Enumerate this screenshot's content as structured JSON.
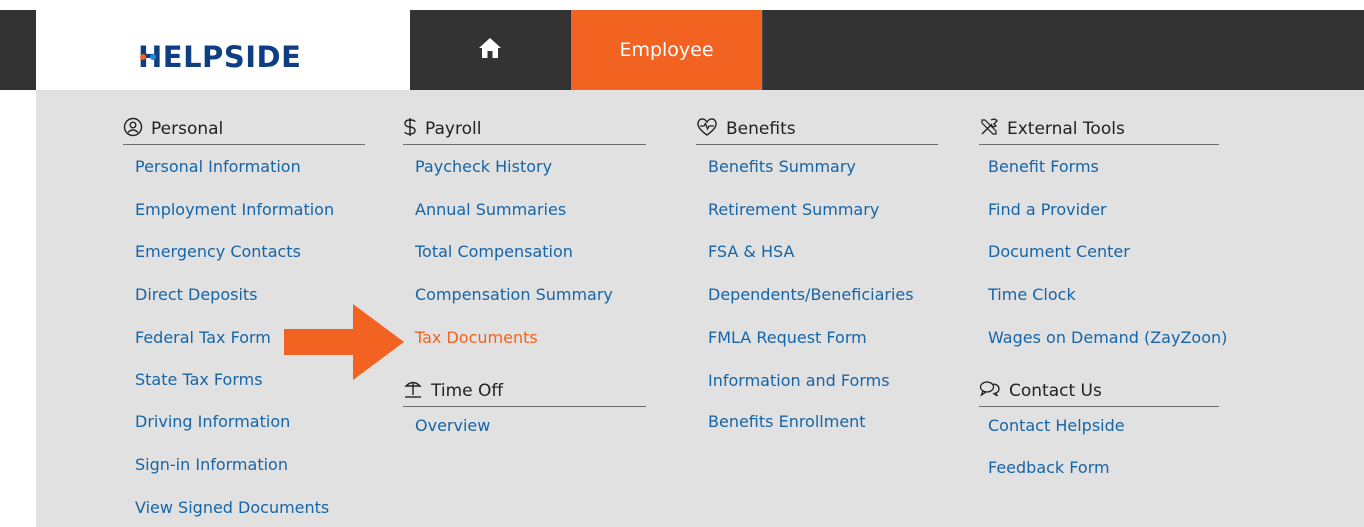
{
  "top_fragment": "(",
  "brand": {
    "name": "HELPSIDE",
    "dot_colors": [
      "#f26322",
      "#1e88e5"
    ],
    "color": "#0f3f82"
  },
  "nav": {
    "home_icon": "home-icon",
    "active_tab": "Employee",
    "accent": "#f26322",
    "bar_color": "#333333"
  },
  "menu": {
    "personal": {
      "title": "Personal",
      "icon": "user-circle-icon",
      "items": [
        "Personal Information",
        "Employment Information",
        "Emergency Contacts",
        "Direct Deposits",
        "Federal Tax Form",
        "State Tax Forms",
        "Driving Information",
        "Sign-in Information",
        "View Signed Documents"
      ]
    },
    "payroll": {
      "title": "Payroll",
      "icon": "dollar-icon",
      "items": [
        "Paycheck History",
        "Annual Summaries",
        "Total Compensation",
        "Compensation Summary",
        "Tax Documents"
      ]
    },
    "timeoff": {
      "title": "Time Off",
      "icon": "beach-icon",
      "items": [
        "Overview"
      ]
    },
    "benefits": {
      "title": "Benefits",
      "icon": "heart-pulse-icon",
      "items": [
        "Benefits Summary",
        "Retirement Summary",
        "FSA & HSA",
        "Dependents/Beneficiaries",
        "FMLA Request Form",
        "Information and Forms",
        "Benefits Enrollment"
      ]
    },
    "external": {
      "title": "External Tools",
      "icon": "tools-icon",
      "items": [
        "Benefit Forms",
        "Find a Provider",
        "Document Center",
        "Time Clock",
        "Wages on Demand (ZayZoon)"
      ]
    },
    "contact": {
      "title": "Contact Us",
      "icon": "chat-icon",
      "items": [
        "Contact Helpside",
        "Feedback Form"
      ]
    },
    "link_color": "#1565a8",
    "highlight": "Tax Documents"
  }
}
